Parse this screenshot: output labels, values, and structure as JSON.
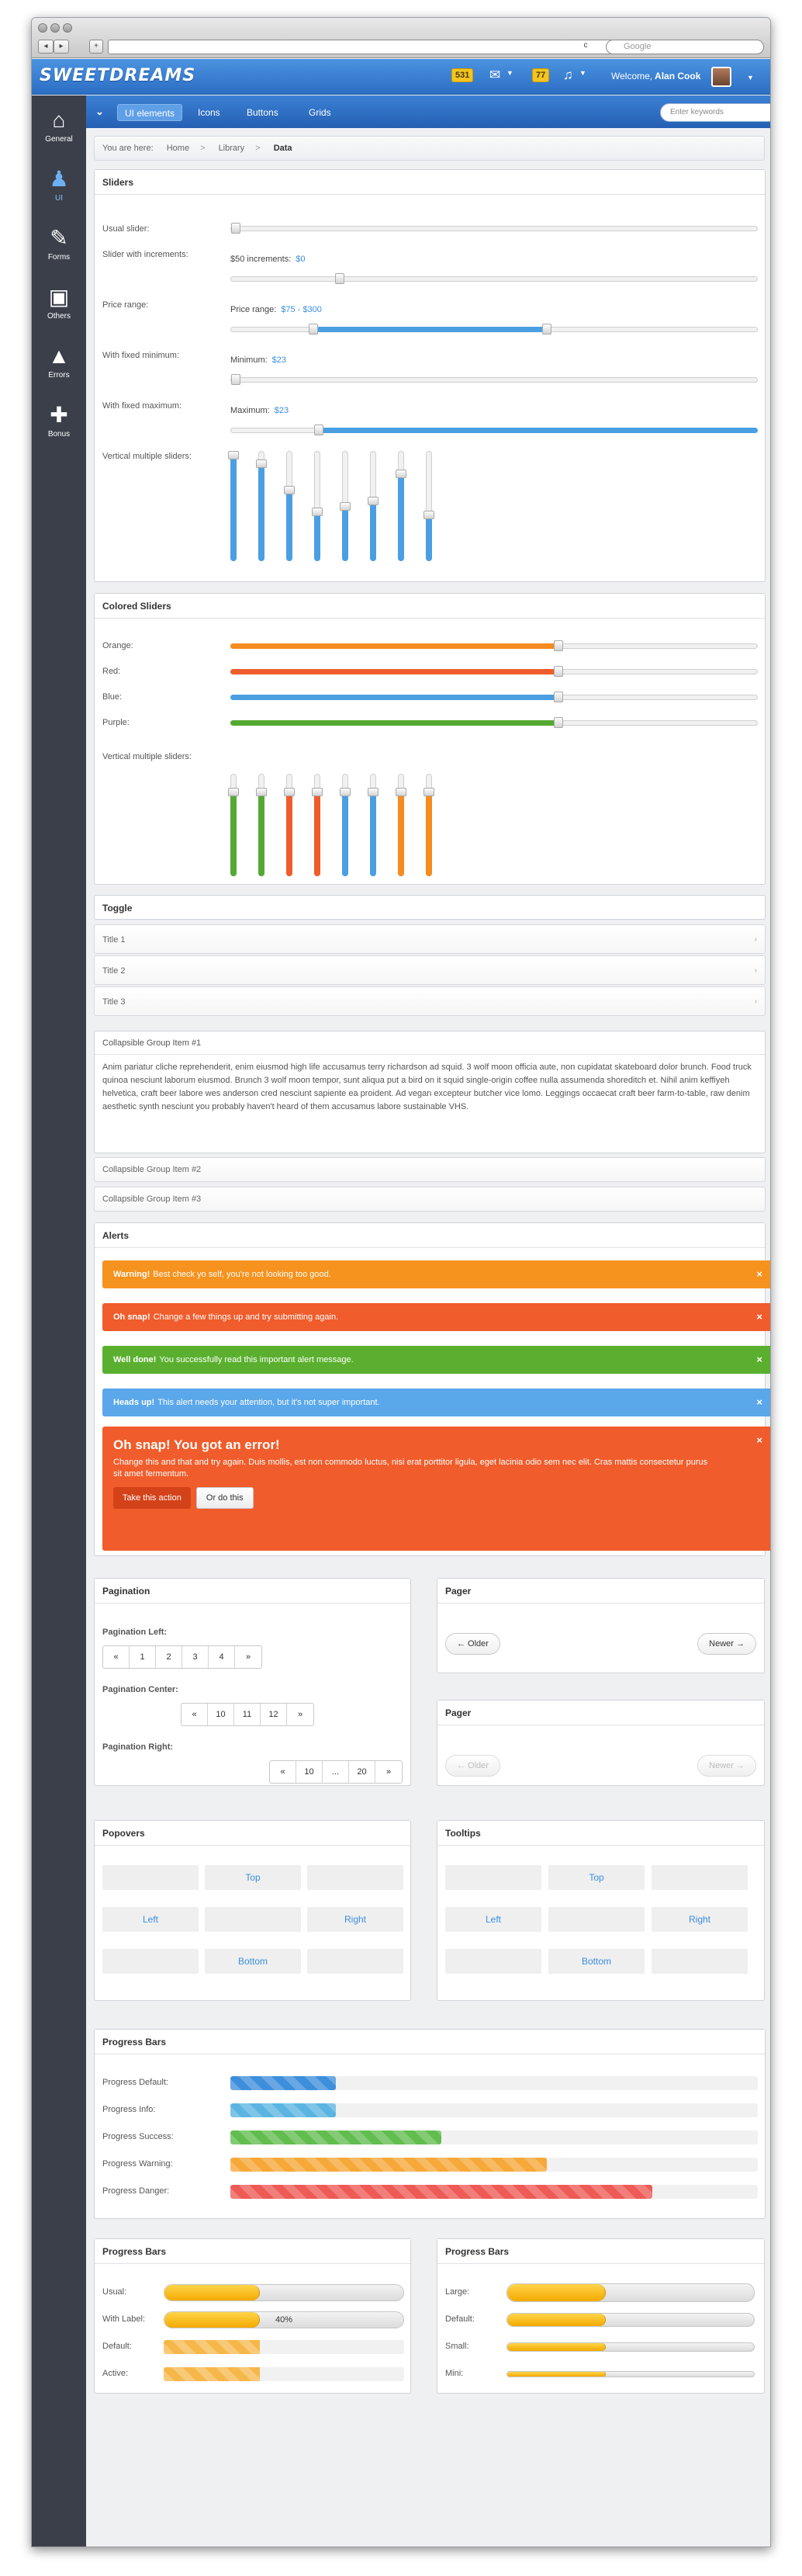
{
  "browser": {
    "back": "◂",
    "fwd": "▸",
    "plus": "+",
    "url": "",
    "reload": "c",
    "search_placeholder": "Google"
  },
  "app": {
    "logo": "SWEETDREAMS",
    "badge1": "531",
    "badge2": "77",
    "welcome_prefix": "Welcome,",
    "user": "Alan Cook"
  },
  "sidebar": {
    "items": [
      {
        "label": "General",
        "icon": "home-icon",
        "glyph": "⌂"
      },
      {
        "label": "UI",
        "icon": "users-icon",
        "glyph": "♟"
      },
      {
        "label": "Forms",
        "icon": "edit-icon",
        "glyph": "✎"
      },
      {
        "label": "Others",
        "icon": "briefcase-icon",
        "glyph": "▣"
      },
      {
        "label": "Errors",
        "icon": "warning-icon",
        "glyph": "▲"
      },
      {
        "label": "Bonus",
        "icon": "gift-icon",
        "glyph": "✚"
      }
    ]
  },
  "secbar": {
    "tabs": [
      "UI elements",
      "Icons",
      "Buttons",
      "Grids"
    ],
    "search_placeholder": "Enter keywords"
  },
  "breadcrumb": {
    "prefix": "You are here:",
    "items": [
      "Home",
      "Library",
      "Data"
    ],
    "sep": ">"
  },
  "sliders": {
    "title": "Sliders",
    "usual": "Usual slider:",
    "increments": "Slider with increments:",
    "increments_text": "$50 increments:",
    "increments_value": "$0",
    "price": "Price range:",
    "price_text": "Price range:",
    "price_value": "$75 - $300",
    "fixed_min": "With fixed minimum:",
    "min_text": "Minimum:",
    "min_value": "$23",
    "fixed_max": "With fixed maximum:",
    "max_text": "Maximum:",
    "max_value": "$23",
    "vertical": "Vertical multiple sliders:",
    "vertical_levels": [
      1.0,
      0.92,
      0.66,
      0.45,
      0.5,
      0.55,
      0.82,
      0.42
    ],
    "usual_value": 0,
    "increments_level": 0.2,
    "price_range": [
      0.15,
      0.6
    ],
    "fixed_min_level": 0,
    "fixed_max_level": 0.16
  },
  "colored": {
    "title": "Colored Sliders",
    "rows": [
      {
        "label": "Orange:",
        "color": "#f68b1f",
        "level": 0.62
      },
      {
        "label": "Red:",
        "color": "#f05c2b",
        "level": 0.62
      },
      {
        "label": "Blue:",
        "color": "#4a9fe3",
        "level": 0.62
      },
      {
        "label": "Purple:",
        "color": "#54a932",
        "level": 0.62
      }
    ],
    "vertical": "Vertical multiple sliders:",
    "vertical_bars": [
      {
        "color": "#54a932",
        "level": 0.85
      },
      {
        "color": "#54a932",
        "level": 0.85
      },
      {
        "color": "#f05c2b",
        "level": 0.85
      },
      {
        "color": "#f05c2b",
        "level": 0.85
      },
      {
        "color": "#4a9fe3",
        "level": 0.85
      },
      {
        "color": "#4a9fe3",
        "level": 0.85
      },
      {
        "color": "#f68b1f",
        "level": 0.85
      },
      {
        "color": "#f68b1f",
        "level": 0.85
      }
    ]
  },
  "toggle": {
    "title": "Toggle",
    "items": [
      "Title 1",
      "Title 2",
      "Title 3"
    ],
    "arrow": "›"
  },
  "collapse": {
    "item1": "Collapsible Group Item #1",
    "body": "Anim pariatur cliche reprehenderit, enim eiusmod high life accusamus terry richardson ad squid. 3 wolf moon officia aute, non cupidatat skateboard dolor brunch. Food truck quinoa nesciunt laborum eiusmod. Brunch 3 wolf moon tempor, sunt aliqua put a bird on it squid single-origin coffee nulla assumenda shoreditch et. Nihil anim keffiyeh helvetica, craft beer labore wes anderson cred nesciunt sapiente ea proident. Ad vegan excepteur butcher vice lomo. Leggings occaecat craft beer farm-to-table, raw denim aesthetic synth nesciunt you probably haven't heard of them accusamus labore sustainable VHS.",
    "item2": "Collapsible Group Item #2",
    "item3": "Collapsible Group Item #3"
  },
  "alerts": {
    "title": "Alerts",
    "close": "×",
    "list": [
      {
        "strong": "Warning!",
        "text": "Best check yo self, you're not looking too good.",
        "color": "#f6921e"
      },
      {
        "strong": "Oh snap!",
        "text": "Change a few things up and try submitting again.",
        "color": "#f05c2b"
      },
      {
        "strong": "Well done!",
        "text": "You successfully read this important alert message.",
        "color": "#5aaf2e"
      },
      {
        "strong": "Heads up!",
        "text": "This alert needs your attention, but it's not super important.",
        "color": "#5aa7ea"
      }
    ],
    "block_title": "Oh snap! You got an error!",
    "block_text": "Change this and that and try again. Duis mollis, est non commodo luctus, nisi erat porttitor ligula, eget lacinia odio sem nec elit. Cras mattis consectetur purus sit amet fermentum.",
    "block_btn1": "Take this action",
    "block_btn2": "Or do this"
  },
  "pagination": {
    "title": "Pagination",
    "left_label": "Pagination Left:",
    "left": [
      "«",
      "1",
      "2",
      "3",
      "4",
      "»"
    ],
    "center_label": "Pagination Center:",
    "center": [
      "«",
      "10",
      "11",
      "12",
      "»"
    ],
    "right_label": "Pagination Right:",
    "right": [
      "«",
      "10",
      "...",
      "20",
      "»"
    ]
  },
  "pager1": {
    "title": "Pager",
    "older": "← Older",
    "newer": "Newer →"
  },
  "pager2": {
    "title": "Pager",
    "older": "← Older",
    "newer": "Newer →"
  },
  "popovers": {
    "title": "Popovers",
    "top": "Top",
    "left": "Left",
    "right": "Right",
    "bottom": "Bottom"
  },
  "tooltips": {
    "title": "Tooltips",
    "top": "Top",
    "left": "Left",
    "right": "Right",
    "bottom": "Bottom"
  },
  "progress": {
    "title": "Progress Bars",
    "rows": [
      {
        "label": "Progress Default:",
        "color": "#3d8edb",
        "pct": 20
      },
      {
        "label": "Progress Info:",
        "color": "#5bb5e0",
        "pct": 20
      },
      {
        "label": "Progress Success:",
        "color": "#62bd4f",
        "pct": 40
      },
      {
        "label": "Progress Warning:",
        "color": "#f6a839",
        "pct": 60
      },
      {
        "label": "Progress Danger:",
        "color": "#ee5a55",
        "pct": 80
      }
    ]
  },
  "progress_left": {
    "title": "Progress Bars",
    "rows": [
      {
        "label": "Usual:",
        "pct": 40,
        "kind": "yellow"
      },
      {
        "label": "With Label:",
        "pct": 40,
        "kind": "yellow",
        "text": "40%"
      },
      {
        "label": "Default:",
        "pct": 40,
        "kind": "orange"
      },
      {
        "label": "Active:",
        "pct": 40,
        "kind": "orange"
      }
    ]
  },
  "progress_right": {
    "title": "Progress Bars",
    "rows": [
      {
        "label": "Large:",
        "pct": 40,
        "size": "large"
      },
      {
        "label": "Default:",
        "pct": 40,
        "size": "default"
      },
      {
        "label": "Small:",
        "pct": 40,
        "size": "small"
      },
      {
        "label": "Mini:",
        "pct": 40,
        "size": "mini"
      }
    ]
  }
}
